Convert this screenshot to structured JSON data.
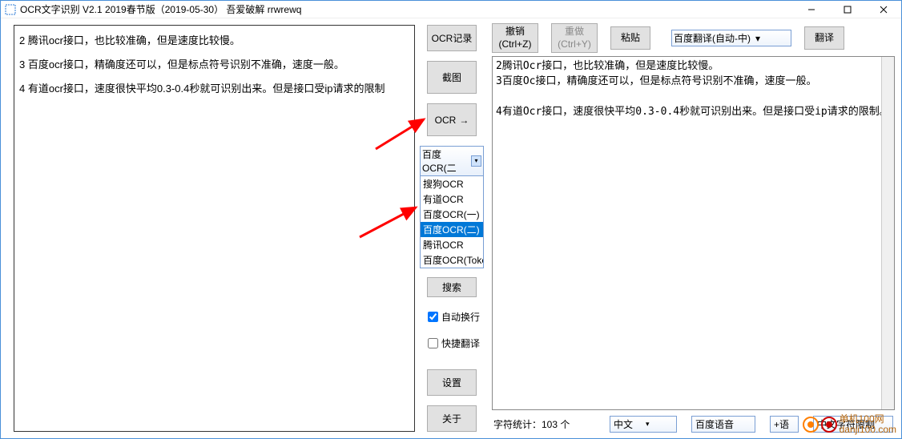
{
  "title": "OCR文字识别 V2.1   2019春节版（2019-05-30）  吾爱破解 rrwrewq",
  "left_lines": [
    "2 腾讯ocr接口，也比较准确，但是速度比较慢。",
    "3 百度ocr接口，精确度还可以，但是标点符号识别不准确，速度一般。",
    "4 有道ocr接口，速度很快平均0.3-0.4秒就可识别出来。但是接口受ip请求的限制"
  ],
  "center": {
    "ocr_record": "OCR记录",
    "screenshot": "截图",
    "ocr": "OCR",
    "engine_selected": "百度OCR(二",
    "engine_options": [
      "搜狗OCR",
      "有道OCR",
      "百度OCR(一)",
      "百度OCR(二)",
      "腾讯OCR",
      "百度OCR(Toke"
    ],
    "search": "搜索",
    "auto_wrap": "自动换行",
    "quick_translate": "快捷翻译",
    "settings": "设置",
    "about": "关于"
  },
  "top_toolbar": {
    "undo": "撤销\n(Ctrl+Z)",
    "redo": "重做\n(Ctrl+Y)",
    "paste": "粘贴",
    "translate_select": "百度翻译(自动-中)",
    "translate": "翻译"
  },
  "right_text": "2腾讯Ocr接口，也比较准确，但是速度比较慢。\n3百度Oc接口，精确度还可以，但是标点符号识别不准确，速度一般。\n\n4有道Ocr接口，速度很快平均0.3-0.4秒就可识别出来。但是接口受ip请求的限制。",
  "bottom": {
    "char_count_label": "字符统计：103 个",
    "lang_select": "中文",
    "voice_select": "百度语音",
    "split_select": "+语",
    "cn_limit": "中文字符限制"
  },
  "watermark": "单机100网\ndanji100.com"
}
